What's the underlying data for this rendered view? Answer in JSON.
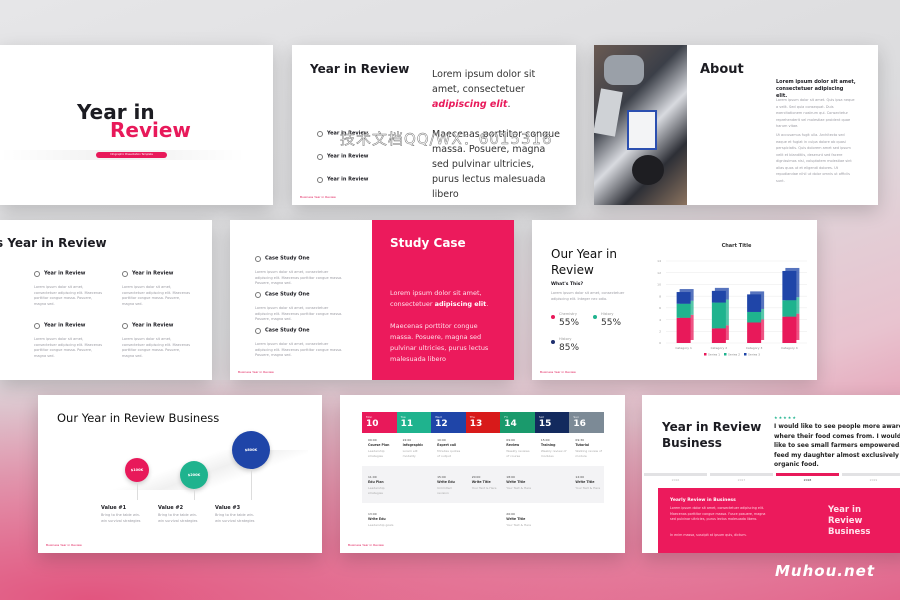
{
  "colors": {
    "accent": "#e8195a",
    "green": "#1fb38e",
    "blue": "#1f45a8",
    "red": "#d81a1a",
    "navy": "#132a5e",
    "gray": "#7c8a96"
  },
  "slide1": {
    "title_line1": "Year in",
    "title_line2": "Review",
    "tag": "Infographic Presentation Template"
  },
  "slide2": {
    "title": "Year in Review",
    "items": [
      "Year in Review",
      "Year in Review",
      "Year in Review"
    ],
    "lead_plain": "Lorem ipsum dolor sit amet, consectetuer ",
    "lead_em": "adipiscing elit",
    "lead_end": ".",
    "body": "Maecenas porttitor congue massa. Posuere, magna sed pulvinar ultricies, purus lectus malesuada libero",
    "footer": "Business Year in Review"
  },
  "slide3": {
    "title": "About",
    "lead": "Lorem ipsum dolor sit amet, consectetuer adipiscing elit.",
    "p1": "Lorem ipsum dolor sit amet. Quis ipsa neque a velit. Sed quia consequat. Duis exercitationem nostrum qui. Consectetur reprehenderit vel molestiae proident quae harum vitae.",
    "p2": "Ut accusamus fugit ulla. Architecto sed eaque et fugiat in culpa dolore ab quasi perspiciatis. Quis dolorem amet sed ipsum velit et blanditiis, deserunt sed facere dignissimos nisi, voluptatem molestiae sint alias quos ut et eligendi dolores. Ut repudiandae nihil ut dolor omnis ut officiis sunt."
  },
  "slide4": {
    "title": "s Year in Review",
    "cards": [
      {
        "title": "Year in Review",
        "text": "Lorem ipsum dolor sit amet, consectetuer adipiscing elit. Maecenas porttitor congue massa. Posuere, magna sed."
      },
      {
        "title": "Year in Review",
        "text": "Lorem ipsum dolor sit amet, consectetuer adipiscing elit. Maecenas porttitor congue massa. Posuere, magna sed."
      },
      {
        "title": "Year in Review",
        "text": "Lorem ipsum dolor sit amet, consectetuer adipiscing elit. Maecenas porttitor congue massa. Posuere, magna sed."
      },
      {
        "title": "Year in Review",
        "text": "Lorem ipsum dolor sit amet, consectetuer adipiscing elit. Maecenas porttitor congue massa. Posuere, magna sed."
      }
    ]
  },
  "slide5": {
    "cases": [
      {
        "title": "Case Study One",
        "text": "Lorem ipsum dolor sit amet, consectetuer adipiscing elit. Maecenas porttitor congue massa. Posuere, magna sed."
      },
      {
        "title": "Case Study One",
        "text": "Lorem ipsum dolor sit amet, consectetuer adipiscing elit. Maecenas porttitor congue massa. Posuere, magna sed."
      },
      {
        "title": "Case Study One",
        "text": "Lorem ipsum dolor sit amet, consectetuer adipiscing elit. Maecenas porttitor congue massa. Posuere, magna sed."
      }
    ],
    "title": "Study Case",
    "lead_plain": "Lorem ipsum dolor sit amet, consectetuer ",
    "lead_em": "adipiscing elit",
    "lead_end": ".",
    "body": "Maecenas porttitor congue massa. Posuere, magna sed pulvinar ultricies, purus lectus malesuada libero",
    "footer": "Business Year in Review"
  },
  "slide6": {
    "title": "Our Year in Review",
    "subtitle": "What's This?",
    "text": "Lorem ipsum dolor sit amet, consectetuer adipiscing elit. Integer nec odio.",
    "stats": [
      {
        "label": "Chemistry",
        "value": "55%",
        "color": "#e8195a"
      },
      {
        "label": "History",
        "value": "55%",
        "color": "#1fb38e"
      },
      {
        "label": "History",
        "value": "85%",
        "color": "#1f2f6e"
      }
    ],
    "footer": "Business Year in Review"
  },
  "chart_data": {
    "type": "bar",
    "stacked": true,
    "title": "Chart Title",
    "categories": [
      "Category 1",
      "Category 2",
      "Category 3",
      "Category 4"
    ],
    "series": [
      {
        "name": "Series 1",
        "values": [
          4.3,
          2.5,
          3.5,
          4.5
        ],
        "color": "#e8195a"
      },
      {
        "name": "Series 2",
        "values": [
          2.4,
          4.4,
          1.8,
          2.8
        ],
        "color": "#1fb38e"
      },
      {
        "name": "Series 3",
        "values": [
          2,
          2,
          3,
          5
        ],
        "color": "#1f45a8"
      }
    ],
    "ylim": [
      0,
      14
    ],
    "yticks": [
      "0",
      "2",
      "4",
      "6",
      "8",
      "10",
      "12",
      "14"
    ],
    "grid": true,
    "legend": "bottom"
  },
  "slide7": {
    "title": "Our Year in Review Business",
    "values": [
      {
        "amount": "$100K",
        "label": "Value #1",
        "text": "Bring to the table win-win survival strategies",
        "color": "#e8195a"
      },
      {
        "amount": "$200K",
        "label": "Value #2",
        "text": "Bring to the table win-win survival strategies",
        "color": "#1fb38e"
      },
      {
        "amount": "$800K",
        "label": "Value #3",
        "text": "Bring to the table win-win survival strategies",
        "color": "#1f45a8"
      }
    ],
    "footer": "Business Year in Review"
  },
  "slide8": {
    "days": [
      {
        "name": "Mon",
        "num": "10",
        "color": "#e8195a"
      },
      {
        "name": "Tue",
        "num": "11",
        "color": "#1fb38e"
      },
      {
        "name": "Wed",
        "num": "12",
        "color": "#1f45a8"
      },
      {
        "name": "Thu",
        "num": "13",
        "color": "#d81a1a"
      },
      {
        "name": "Fri",
        "num": "14",
        "color": "#1a9a6c"
      },
      {
        "name": "Sat",
        "num": "15",
        "color": "#132a5e"
      },
      {
        "name": "Sun",
        "num": "16",
        "color": "#7c8a96"
      }
    ],
    "rows": [
      [
        {
          "t": "09:00",
          "n": "Course Plan",
          "d": "Leadership strategies"
        },
        {
          "t": "22:00",
          "n": "Infographic",
          "d": "Lorem elit modality"
        },
        {
          "t": "10:00",
          "n": "Expert call",
          "d": "Minutes quotes of output"
        },
        null,
        {
          "t": "09:00",
          "n": "Review",
          "d": "Weekly reviews of course"
        },
        {
          "t": "15:00",
          "n": "Training",
          "d": "Weekly review of modules"
        },
        {
          "t": "09:30",
          "n": "Tutorial",
          "d": "Walking review of module"
        }
      ],
      [
        {
          "t": "11:00",
          "n": "Edu Plan",
          "d": "Leadership strategies"
        },
        null,
        {
          "t": "15:00",
          "n": "Write Edu",
          "d": "Unlimited revision"
        },
        {
          "t": "20:00",
          "n": "Write Title",
          "d": "Your Text & Here"
        },
        {
          "t": "18:00",
          "n": "Write Title",
          "d": "Your Text & Here"
        },
        null,
        {
          "t": "12:00",
          "n": "Write Title",
          "d": "Your Text & Here"
        }
      ],
      [
        {
          "t": "13:00",
          "n": "Write Edu",
          "d": "Leadership goals"
        },
        null,
        null,
        null,
        {
          "t": "20:00",
          "n": "Write Title",
          "d": "Your Text & Here"
        },
        null,
        null
      ]
    ],
    "footer": "Business Year in Review"
  },
  "slide9": {
    "title": "Year in Review Business",
    "stars": "★★★★★",
    "quote": "I would like to see people more aware of where their food comes from. I would like to see small farmers empowered. I feed my daughter almost exclusively organic food.",
    "years": [
      "2016",
      "2017",
      "2018",
      "2019"
    ],
    "active_year": 2,
    "box_title": "Yearly Review in Business",
    "box_text": "Lorem ipsum dolor sit amet, consectetuer adipiscing elit. Maecenas porttitor congue massa. Fusce posuere, magna sed pulvinar ultricies, purus lectus malesuada libero.",
    "box_note": "In enim massa, suscipit at ipsum quis, dictum.",
    "box_heading": "Year in Review Business"
  },
  "watermarks": {
    "center": "技术文档QQ/WX：6015316",
    "corner": "Muhou.net"
  }
}
